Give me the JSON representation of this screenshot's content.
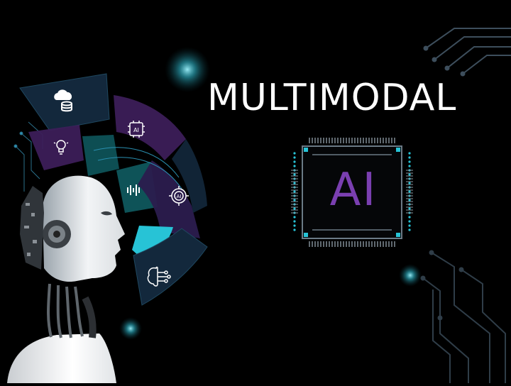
{
  "headline": "MULTIMODAL",
  "chip_label": "AI",
  "icons": {
    "cloud": "cloud-database-icon",
    "idea": "lightbulb-gear-icon",
    "chip": "ai-chip-icon",
    "waveform": "audio-waveform-icon",
    "gear": "ai-gear-icon",
    "brain": "brain-circuit-icon"
  },
  "colors": {
    "background": "#000000",
    "headline": "#ffffff",
    "chip_label": "#7a3fb0",
    "accent_cyan": "#27c3d6",
    "accent_purple": "#5a2a7a",
    "accent_teal": "#0f5c62",
    "panel_navy": "#13283c"
  }
}
